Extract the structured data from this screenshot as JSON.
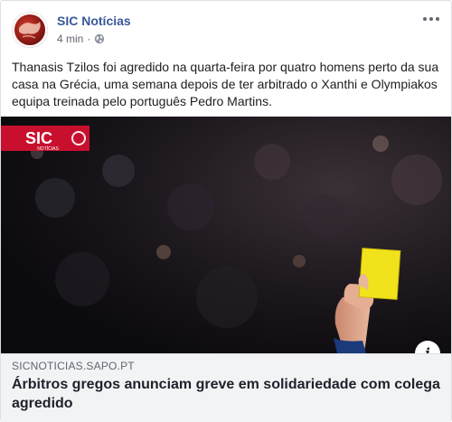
{
  "post": {
    "page_name": "SIC Notícias",
    "timestamp": "4 min",
    "separator": "·",
    "privacy_icon": "globe-icon",
    "text": "Thanasis Tzilos foi agredido na quarta-feira por quatro homens perto da sua casa na Grécia, uma semana depois de ter arbitrado o Xanthi e Olympiakos equipa treinada pelo português Pedro Martins."
  },
  "image": {
    "logo_text": "SIC",
    "logo_subtext": "NOTÍCIAS",
    "description_icon": "info-icon"
  },
  "link": {
    "domain": "SICNOTICIAS.SAPO.PT",
    "title": "Árbitros gregos anunciam greve em solidariedade com colega agredido"
  },
  "colors": {
    "page_name": "#385898",
    "card_yellow": "#f2e21c",
    "sic_red": "#c8102e",
    "link_bg": "#f2f3f5"
  }
}
